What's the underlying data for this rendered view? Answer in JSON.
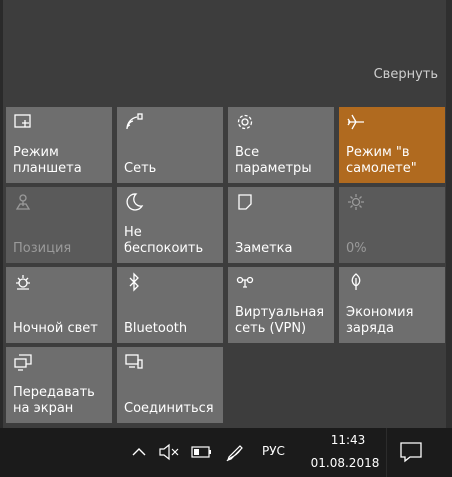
{
  "panel": {
    "collapse_label": "Свернуть"
  },
  "tiles": [
    {
      "label": "Режим\nпланшета",
      "icon": "tablet-mode-icon",
      "state": "normal"
    },
    {
      "label": "Сеть",
      "icon": "network-icon",
      "state": "normal"
    },
    {
      "label": "Все\nпараметры",
      "icon": "gear-icon",
      "state": "normal"
    },
    {
      "label": "Режим \"в\nсамолете\"",
      "icon": "airplane-icon",
      "state": "active"
    },
    {
      "label": "Позиция",
      "icon": "location-icon",
      "state": "disabled"
    },
    {
      "label": "Не\nбеспокоить",
      "icon": "moon-icon",
      "state": "normal"
    },
    {
      "label": "Заметка",
      "icon": "note-icon",
      "state": "normal"
    },
    {
      "label": "0%",
      "icon": "brightness-icon",
      "state": "disabled"
    },
    {
      "label": "Ночной свет",
      "icon": "night-light-icon",
      "state": "normal"
    },
    {
      "label": "Bluetooth",
      "icon": "bluetooth-icon",
      "state": "normal"
    },
    {
      "label": "Виртуальная\nсеть (VPN)",
      "icon": "vpn-icon",
      "state": "normal"
    },
    {
      "label": "Экономия\nзаряда",
      "icon": "leaf-icon",
      "state": "normal"
    },
    {
      "label": "Передавать\nна экран",
      "icon": "project-icon",
      "state": "normal"
    },
    {
      "label": "Соединиться",
      "icon": "connect-icon",
      "state": "normal"
    }
  ],
  "taskbar": {
    "language": "РУС",
    "time": "11:43",
    "date": "01.08.2018",
    "icons": [
      "chevron-up-icon",
      "speaker-muted-icon",
      "battery-icon",
      "pen-icon",
      "action-center-icon"
    ]
  },
  "colors": {
    "tile": "#6e6e6e",
    "tile_active": "#b06a1f",
    "panel": "#3d3d3d",
    "taskbar": "#1b1b1b"
  }
}
